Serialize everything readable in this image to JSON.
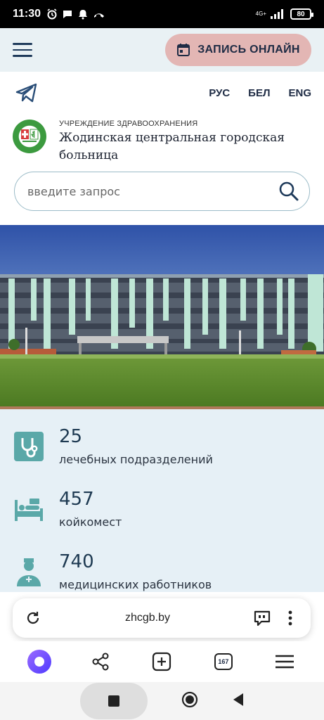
{
  "status_bar": {
    "time": "11:30",
    "network": "4G+",
    "battery": "80"
  },
  "header": {
    "record_online_label": "ЗАПИСЬ ОНЛАЙН"
  },
  "languages": [
    "РУС",
    "БЕЛ",
    "ENG"
  ],
  "organization": {
    "subtitle": "УЧРЕЖДЕНИЕ ЗДРАВООХРАНЕНИЯ",
    "name_line1": "Жодинская центральная городская",
    "name_line2": "больница"
  },
  "search": {
    "placeholder": "введите запрос"
  },
  "stats": [
    {
      "number": "25",
      "label": "лечебных подразделений",
      "icon": "stethoscope-icon"
    },
    {
      "number": "457",
      "label": "койкомест",
      "icon": "hospital-bed-icon"
    },
    {
      "number": "740",
      "label": "медицинских работников",
      "icon": "doctor-icon"
    }
  ],
  "browser": {
    "url": "zhcgb.by",
    "tabs_count": "167"
  },
  "colors": {
    "nav_bg": "#e9f1f4",
    "record_button": "#e3b6b4",
    "stats_bg": "#e6f0f6",
    "icon_teal": "#5aa8a8",
    "assistant_purple": "#7b5cff"
  }
}
